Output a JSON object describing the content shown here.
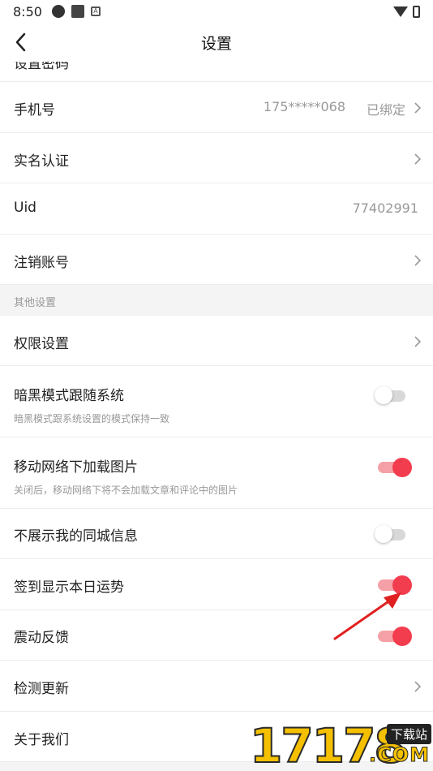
{
  "status_bar": {
    "time": "8:50"
  },
  "header": {
    "title": "设置"
  },
  "clipped_row": {
    "label": "设置密码"
  },
  "rows": {
    "phone": {
      "label": "手机号",
      "value": "175*****068",
      "status": "已绑定"
    },
    "realname": {
      "label": "实名认证"
    },
    "uid": {
      "label": "Uid",
      "value": "77402991"
    },
    "cancel_account": {
      "label": "注销账号"
    }
  },
  "section_other": {
    "title": "其他设置"
  },
  "settings": {
    "permissions": {
      "label": "权限设置"
    },
    "dark_mode": {
      "label": "暗黑模式跟随系统",
      "sub": "暗黑模式跟系统设置的模式保持一致",
      "on": false
    },
    "mobile_images": {
      "label": "移动网络下加载图片",
      "sub": "关闭后，移动网络下将不会加载文章和评论中的图片",
      "on": true
    },
    "hide_city": {
      "label": "不展示我的同城信息",
      "on": false
    },
    "checkin_fortune": {
      "label": "签到显示本日运势",
      "on": true
    },
    "vibration": {
      "label": "震动反馈",
      "on": true
    },
    "check_update": {
      "label": "检测更新"
    },
    "about": {
      "label": "关于我们"
    }
  },
  "colors": {
    "accent": "#f23d4f",
    "accent_light": "#f5a0a6",
    "annotation": "#e02020"
  },
  "watermark": {
    "digits": "17178",
    "badge": "下载站",
    "domain": ".COM"
  }
}
